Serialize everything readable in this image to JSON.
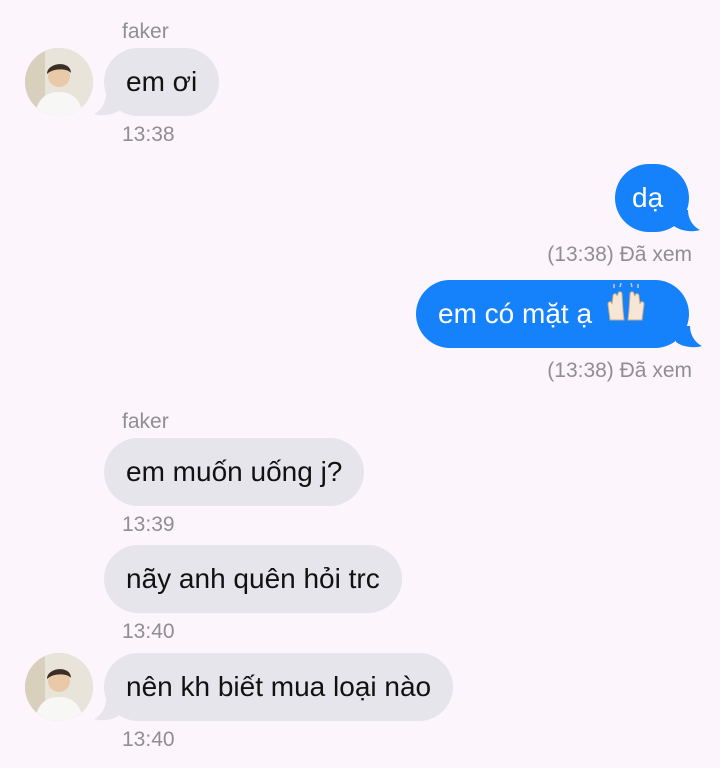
{
  "messages": [
    {
      "sender": "faker",
      "text": "em ơi",
      "time": "13:38"
    },
    {
      "text": "dạ",
      "status": "(13:38) Đã xem"
    },
    {
      "text": "em có mặt ạ",
      "emoji": "raising-hands",
      "status": "(13:38) Đã xem"
    },
    {
      "sender": "faker",
      "text": "em muốn uống j?",
      "time": "13:39"
    },
    {
      "text": "nãy anh quên hỏi trc",
      "time": "13:40"
    },
    {
      "text": "nên kh biết mua loại nào",
      "time": "13:40"
    }
  ],
  "colors": {
    "background": "#FCF5FC",
    "incoming_bubble": "#E6E5EB",
    "outgoing_bubble": "#1581FB",
    "meta_text": "#8E8E93"
  }
}
